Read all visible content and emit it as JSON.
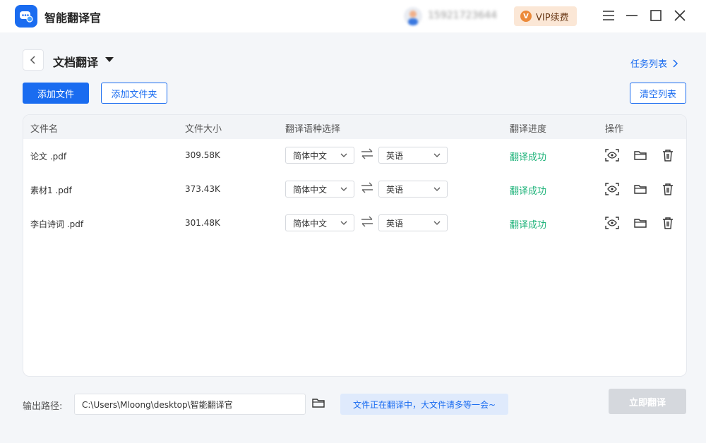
{
  "app": {
    "title": "智能翻译官",
    "user_phone": "15921723644",
    "vip_label": "VIP续费",
    "vip_icon": "V"
  },
  "header": {
    "page_title": "文档翻译",
    "task_list": "任务列表"
  },
  "toolbar": {
    "add_file": "添加文件",
    "add_folder": "添加文件夹",
    "clear_list": "清空列表"
  },
  "table": {
    "headers": {
      "filename": "文件名",
      "size": "文件大小",
      "language": "翻译语种选择",
      "progress": "翻译进度",
      "actions": "操作"
    },
    "rows": [
      {
        "name": "论文 .pdf",
        "size": "309.58K",
        "source_lang": "简体中文",
        "target_lang": "英语",
        "status": "翻译成功"
      },
      {
        "name": "素材1 .pdf",
        "size": "373.43K",
        "source_lang": "简体中文",
        "target_lang": "英语",
        "status": "翻译成功"
      },
      {
        "name": "李白诗词 .pdf",
        "size": "301.48K",
        "source_lang": "简体中文",
        "target_lang": "英语",
        "status": "翻译成功"
      }
    ]
  },
  "footer": {
    "output_label": "输出路径:",
    "output_path": "C:\\Users\\Mloong\\desktop\\智能翻译官",
    "notice": "文件正在翻译中，大文件请多等一会~",
    "translate_now": "立即翻译"
  },
  "colors": {
    "accent": "#1a6cf0",
    "success": "#1fb37a",
    "vip_bg": "#fbe7d6",
    "disabled": "#d5d8dd"
  },
  "icons": [
    "app-logo-icon",
    "avatar-icon",
    "minimize-icon",
    "maximize-icon",
    "close-icon",
    "back-icon",
    "caret-down-icon",
    "chevron-right-icon",
    "chevron-down-icon",
    "swap-icon",
    "preview-icon",
    "folder-icon",
    "trash-icon"
  ]
}
